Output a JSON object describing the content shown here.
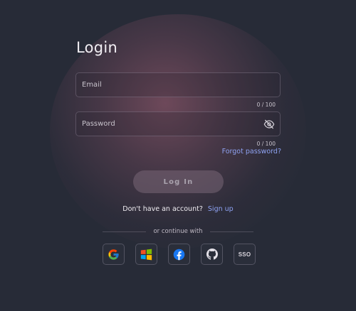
{
  "login": {
    "title": "Login",
    "email": {
      "placeholder": "Email",
      "value": "",
      "counter": "0 / 100"
    },
    "password": {
      "placeholder": "Password",
      "value": "",
      "counter": "0 / 100"
    },
    "forgot_password": "Forgot password?",
    "login_button": "Log In",
    "no_account_text": "Don't have an account?",
    "signup_link": "Sign up",
    "divider_text": "or continue with",
    "social_buttons": [
      {
        "name": "google",
        "icon": "google-icon"
      },
      {
        "name": "microsoft",
        "icon": "microsoft-icon"
      },
      {
        "name": "facebook",
        "icon": "facebook-icon"
      },
      {
        "name": "github",
        "icon": "github-icon"
      },
      {
        "name": "sso",
        "label": "SSO"
      }
    ]
  },
  "colors": {
    "background": "#272b37",
    "link": "#8ea2f2",
    "button": "#786676"
  }
}
